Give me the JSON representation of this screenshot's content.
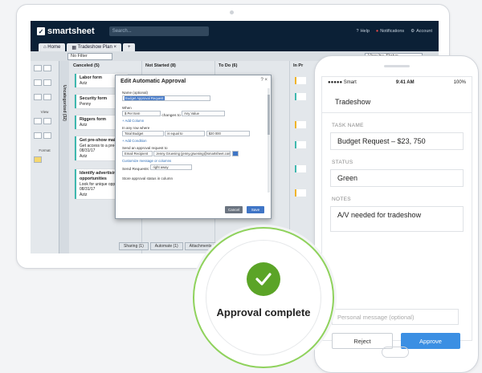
{
  "app": {
    "brand": "smartsheet",
    "search_placeholder": "Search...",
    "top_links": {
      "help": "Help",
      "notifications": "Notifications",
      "account": "Account"
    },
    "tabs": {
      "home": "Home",
      "sheet": "Tradeshow Plan"
    },
    "toolbar": {
      "filter": "No Filter",
      "view": "View by: Status"
    },
    "left_panel": {
      "view": "View",
      "format": "Format"
    }
  },
  "board": {
    "uncategorized": "Uncategorized (32)",
    "columns": [
      {
        "header": "Canceled (5)"
      },
      {
        "header": "Not Started (8)"
      },
      {
        "header": "To Do (6)"
      },
      {
        "header": "In Pr"
      }
    ],
    "cards": [
      {
        "title": "Labor form",
        "sub": "Aziz"
      },
      {
        "title": "Security form",
        "sub": "Penny"
      },
      {
        "title": "Riggers form",
        "sub": "Aziz"
      },
      {
        "title": "Get pre-show mailin",
        "line2": "Get access to a pre-s",
        "date": "08/31/17",
        "sub": "Aziz"
      },
      {
        "title": "Identify advertising",
        "title2": "opportunities",
        "line2": "Look for unique opp",
        "date": "08/31/17",
        "sub": "Aziz"
      }
    ],
    "bottom_tabs": [
      "Sharing (1)",
      "Automate (1)",
      "Attachments (1)",
      "U"
    ]
  },
  "dialog": {
    "title": "Edit Automatic Approval",
    "name_label": "Name (optional)",
    "name_value": "Budget Approval Request",
    "when_label": "When",
    "when_field": "$ Per Item",
    "changes_to": "changes to",
    "when_value": "Any Value",
    "add_column": "+ Add Column",
    "any_row_label": "In any row where",
    "cond_field": "Total Budget",
    "cond_op": "is equal to",
    "cond_value": "$20 000",
    "add_condition": "+ Add Condition",
    "send_label": "Send an approval request to",
    "recipient_type": "Email Recipient",
    "recipient": "Jenny Gruening (jenny.gruening@smartsheet.com)",
    "customize": "Customize message or columns",
    "send_requests_label": "Send Requests:",
    "send_requests_value": "right away",
    "store_label": "Store approval status in column",
    "cancel": "Cancel",
    "save": "Save",
    "close": "?  ×"
  },
  "overlay": {
    "approval_text": "Approval complete"
  },
  "phone": {
    "carrier": "●●●●● Smart",
    "time": "9:41 AM",
    "battery": "100%",
    "title": "Tradeshow",
    "task_label": "TASK NAME",
    "task_value": "Budget Request – $23, 750",
    "status_label": "STATUS",
    "status_value": "Green",
    "notes_label": "NOTES",
    "notes_value": "A/V needed for tradeshow",
    "message_placeholder": "Personal message (optional)",
    "reject": "Reject",
    "approve": "Approve"
  },
  "colors": {
    "accent": "#3b8fe3",
    "success": "#5ba427",
    "nav": "#0b2036",
    "card_border": "#3fb8af"
  }
}
